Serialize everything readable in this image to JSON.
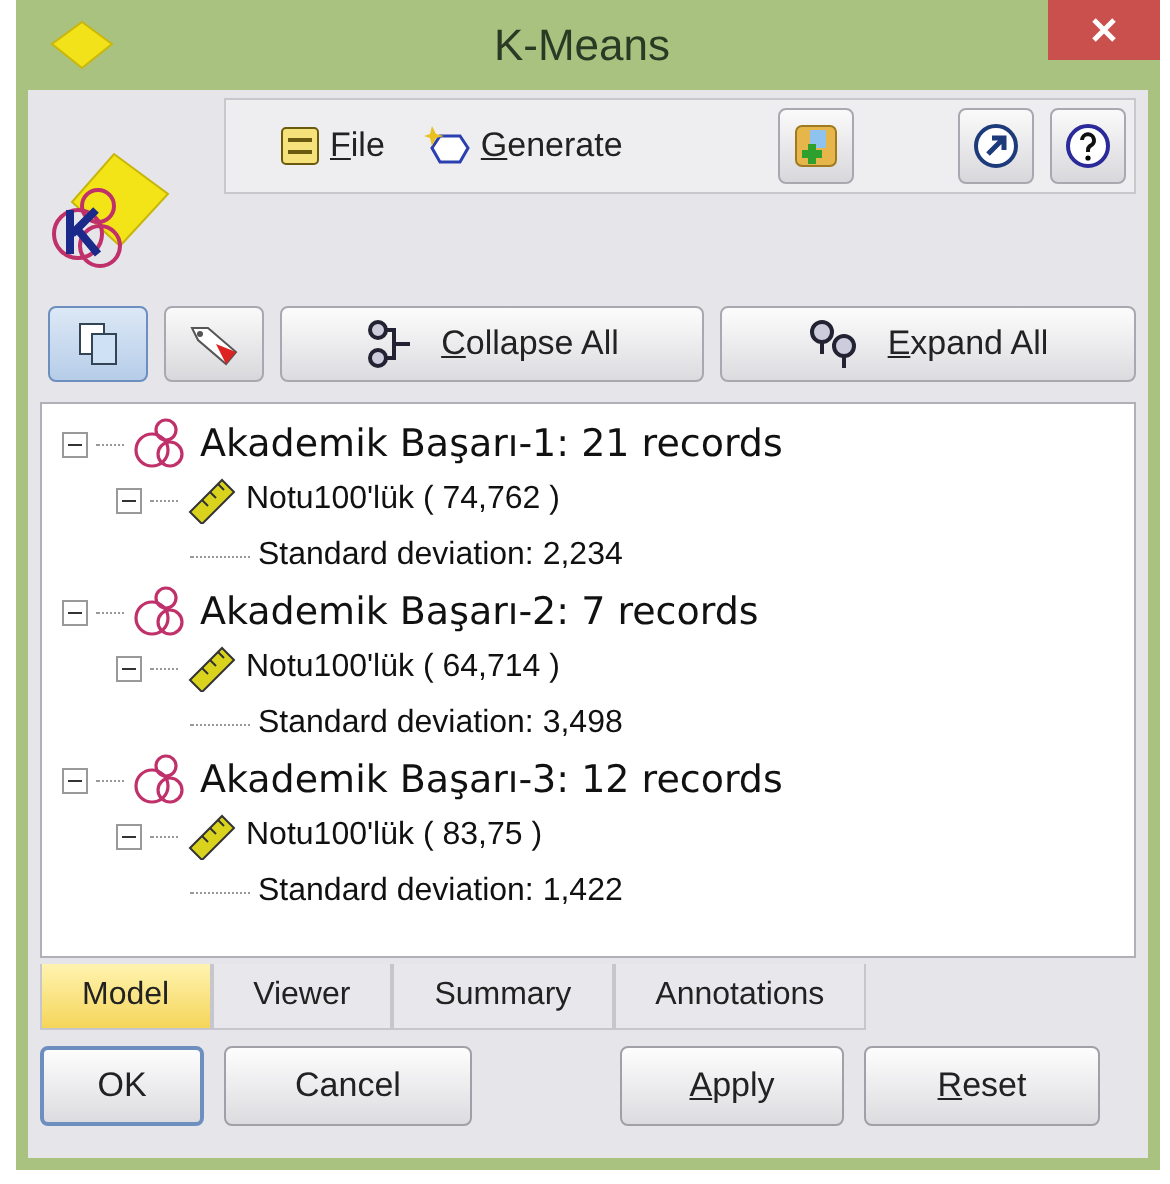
{
  "window": {
    "title": "K-Means"
  },
  "menu": [
    {
      "label": "File",
      "underline_first": true,
      "kind": "file"
    },
    {
      "label": "Generate",
      "underline_first": true,
      "kind": "generate"
    }
  ],
  "tree_buttons": [
    {
      "label": "Collapse All",
      "underline_first": true,
      "kind": "collapse"
    },
    {
      "label": "Expand All",
      "underline_first": true,
      "kind": "expand"
    }
  ],
  "tree": [
    {
      "label": "Akademik Başarı-1: 21 records",
      "expanded": true,
      "children": [
        {
          "label": "Notu100'lük ( 74,762 )",
          "expanded": true,
          "children": [
            {
              "label": "Standard deviation: 2,234"
            }
          ]
        }
      ]
    },
    {
      "label": "Akademik Başarı-2: 7 records",
      "expanded": true,
      "children": [
        {
          "label": "Notu100'lük ( 64,714 )",
          "expanded": true,
          "children": [
            {
              "label": "Standard deviation: 3,498"
            }
          ]
        }
      ]
    },
    {
      "label": "Akademik Başarı-3: 12 records",
      "expanded": true,
      "children": [
        {
          "label": "Notu100'lük ( 83,75 )",
          "expanded": true,
          "children": [
            {
              "label": "Standard deviation: 1,422"
            }
          ]
        }
      ]
    }
  ],
  "tabs": [
    {
      "label": "Model",
      "selected": true
    },
    {
      "label": "Viewer",
      "selected": false
    },
    {
      "label": "Summary",
      "selected": false
    },
    {
      "label": "Annotations",
      "selected": false
    }
  ],
  "buttons": [
    {
      "label": "OK",
      "underline_first": false,
      "default": true
    },
    {
      "label": "Cancel",
      "underline_first": false,
      "default": false
    },
    {
      "label": "Apply",
      "underline_first": true,
      "default": false
    },
    {
      "label": "Reset",
      "underline_first": true,
      "default": false
    }
  ]
}
